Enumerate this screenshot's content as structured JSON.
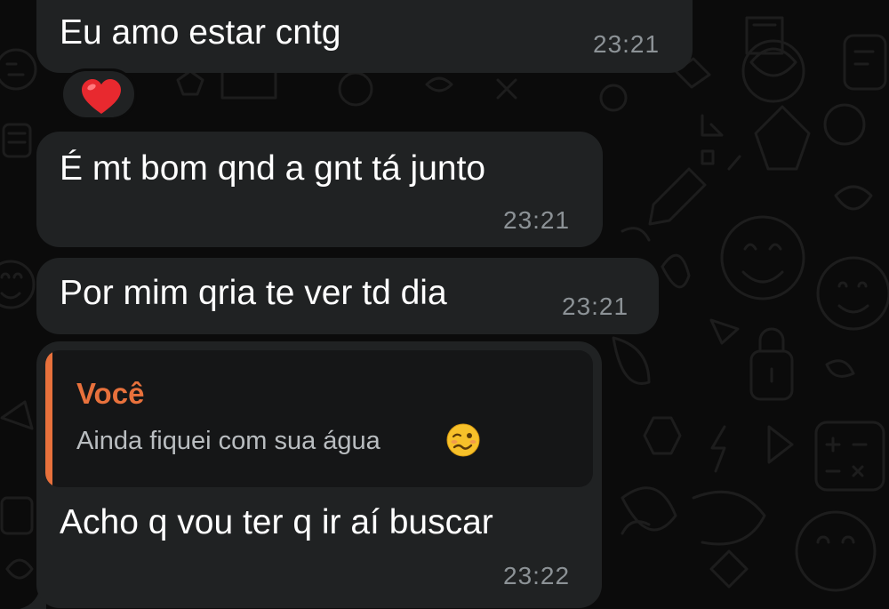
{
  "colors": {
    "background": "#0b0b0b",
    "bubble": "#202223",
    "quote_background": "#151617",
    "accent": "#e8713c",
    "time": "#8c9296"
  },
  "messages": [
    {
      "text": "Eu amo estar cntg",
      "time": "23:21",
      "reaction": "red-heart-emoji"
    },
    {
      "text": "É mt bom qnd a gnt tá junto",
      "time": "23:21"
    },
    {
      "text": "Por mim qria te ver td dia",
      "time": "23:21"
    },
    {
      "reply": {
        "author": "Você",
        "text": "Ainda fiquei com sua água",
        "emoji": "woozy-face-emoji"
      },
      "text": "Acho q vou ter q ir aí buscar",
      "time": "23:22"
    }
  ]
}
